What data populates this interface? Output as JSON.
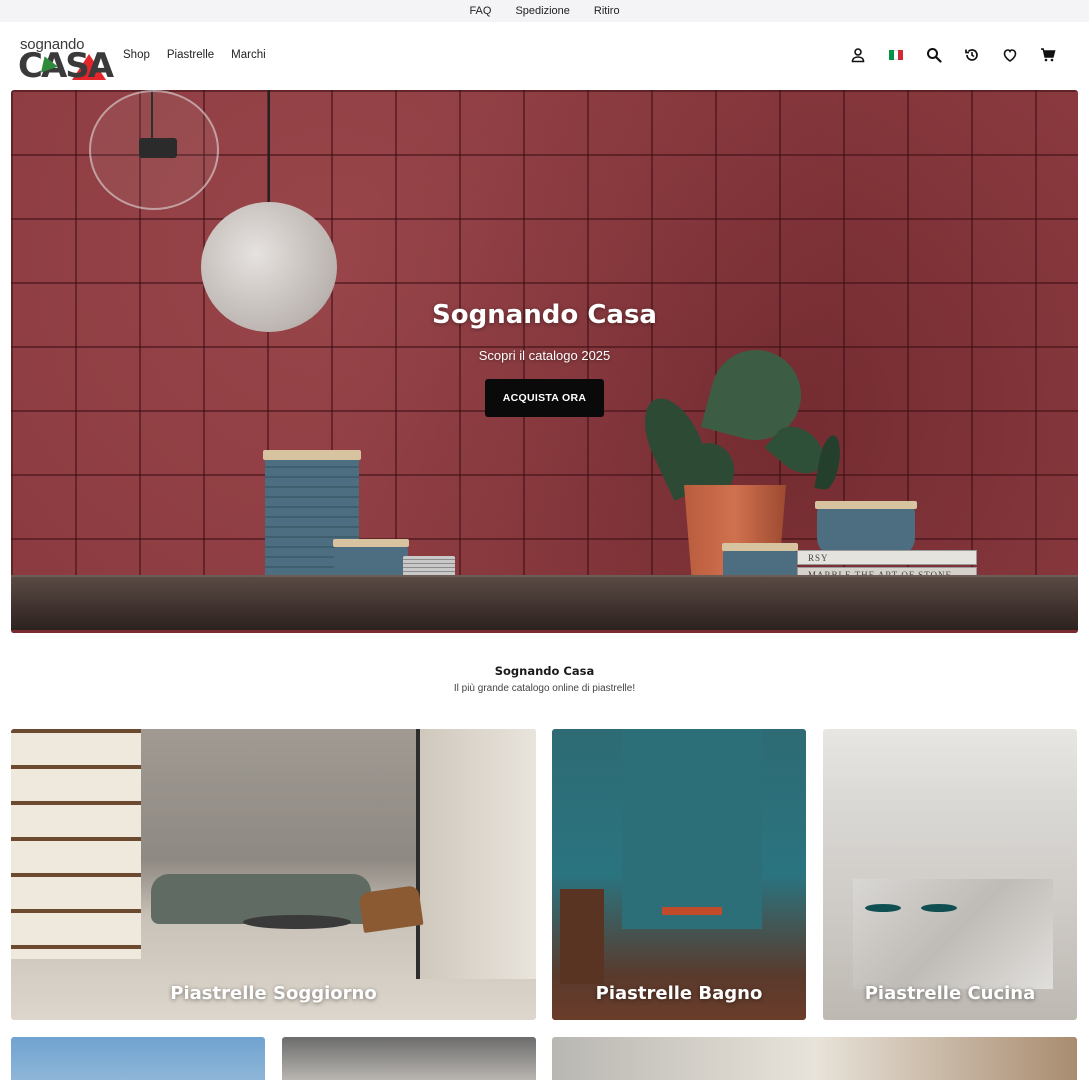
{
  "topbar": {
    "links": [
      "FAQ",
      "Spedizione",
      "Ritiro"
    ]
  },
  "header": {
    "logo": {
      "line1": "sognando",
      "line2": "CASA"
    },
    "nav": [
      "Shop",
      "Piastrelle",
      "Marchi"
    ],
    "icons": [
      "user-icon",
      "italy-flag-icon",
      "search-icon",
      "history-icon",
      "heart-icon",
      "cart-icon"
    ],
    "flag_colors": [
      "#009246",
      "#ffffff",
      "#ce2b37"
    ]
  },
  "hero": {
    "title": "Sognando Casa",
    "subtitle": "Scopri il catalogo 2025",
    "button": "ACQUISTA ORA",
    "book_labels": [
      "RSY",
      "MARBLE THE ART OF STONE"
    ]
  },
  "intro": {
    "title": "Sognando Casa",
    "subtitle": "Il più grande catalogo online di piastrelle!"
  },
  "categories": [
    {
      "label": "Piastrelle Soggiorno"
    },
    {
      "label": "Piastrelle Bagno"
    },
    {
      "label": "Piastrelle Cucina"
    },
    {
      "label": ""
    },
    {
      "label": ""
    },
    {
      "label": ""
    }
  ],
  "colors": {
    "accent_red": "#e2262b",
    "accent_green": "#2e8b3a",
    "button_bg": "#0a0a0a"
  }
}
